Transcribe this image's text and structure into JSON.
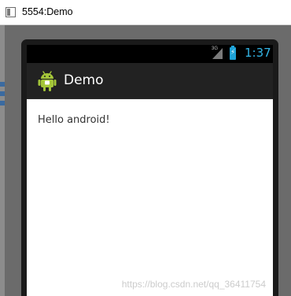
{
  "window": {
    "title": "5554:Demo"
  },
  "status_bar": {
    "network_type": "3G",
    "time": "1:37",
    "accent_color": "#33b5e5"
  },
  "action_bar": {
    "title": "Demo",
    "icon": "android-robot-icon"
  },
  "content": {
    "text": "Hello android!"
  },
  "watermark": {
    "text": "https://blog.csdn.net/qq_36411754"
  }
}
